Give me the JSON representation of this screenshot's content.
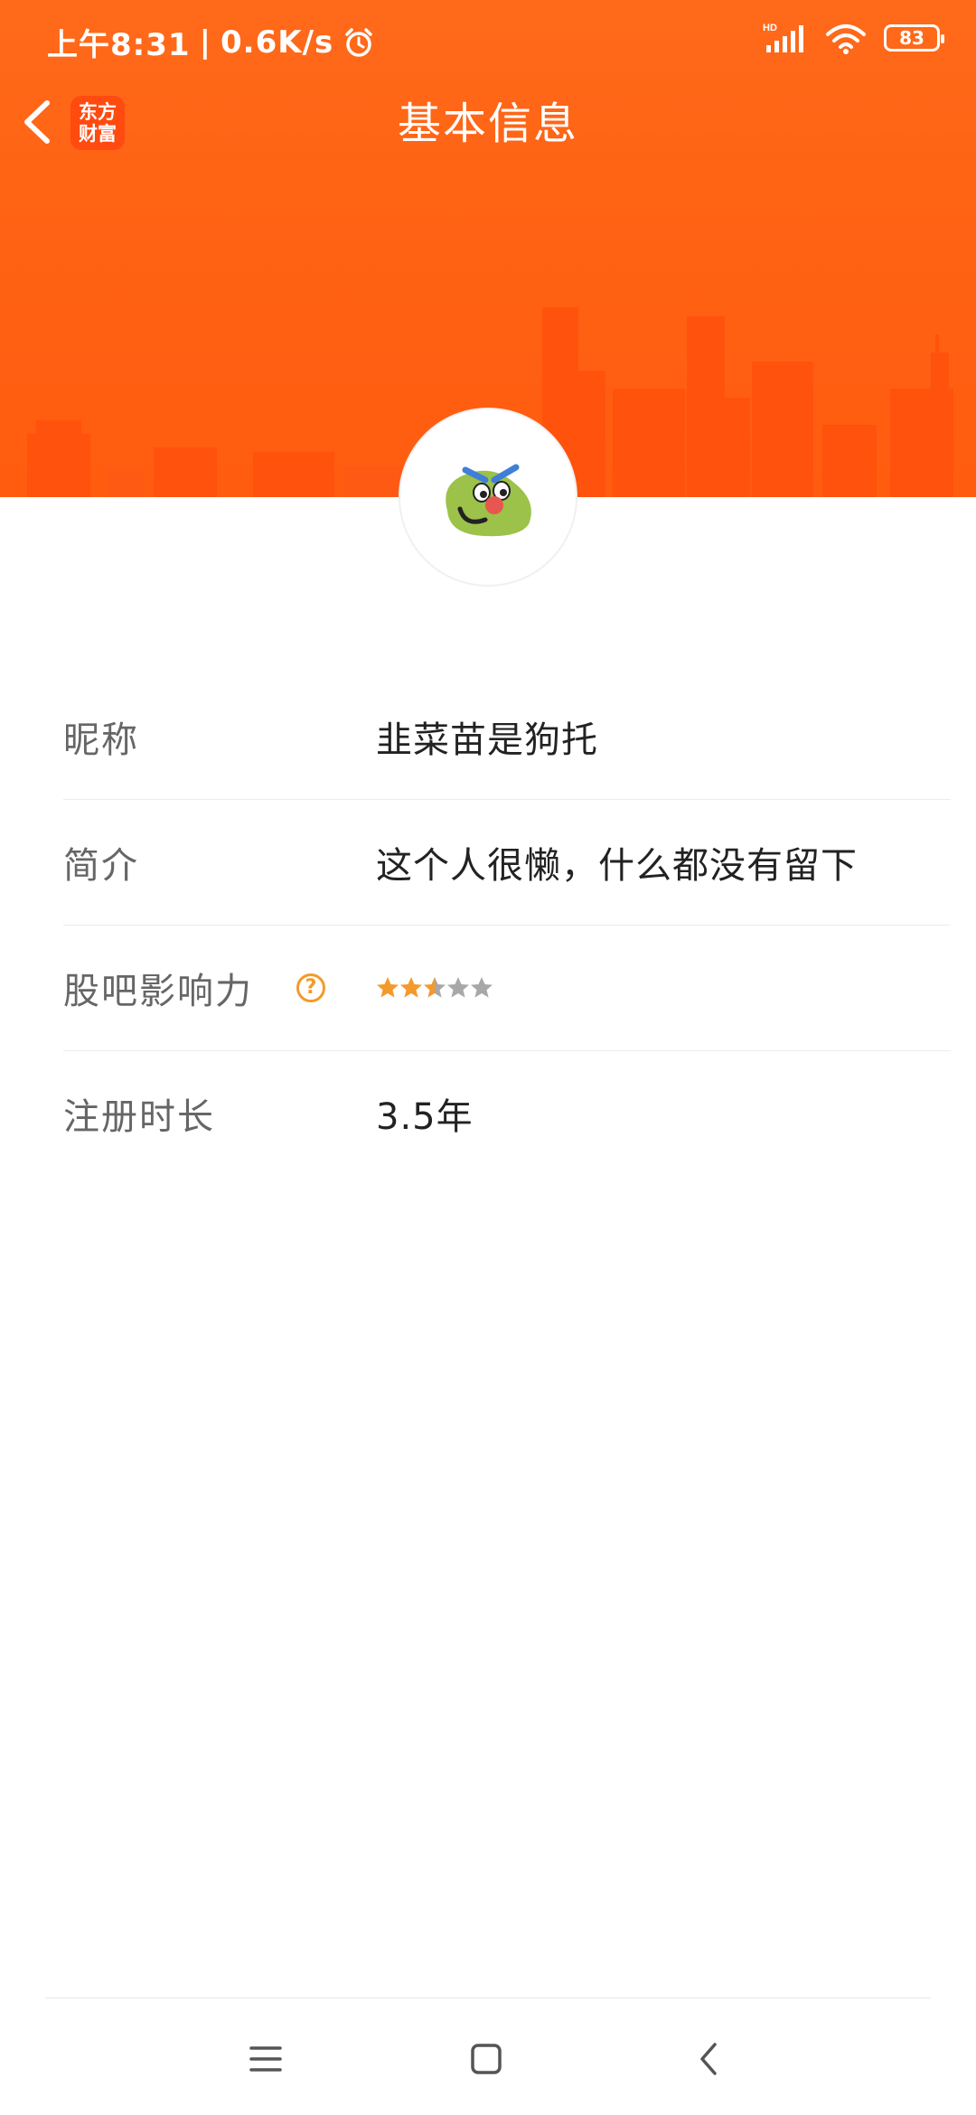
{
  "status_bar": {
    "time": "上午8:31",
    "separator": "|",
    "network_speed": "0.6K/s",
    "network_type": "HD",
    "battery": "83"
  },
  "nav": {
    "app_logo_line1": "东方",
    "app_logo_line2": "财富",
    "title": "基本信息"
  },
  "profile": {
    "rows": [
      {
        "label": "昵称",
        "value": "韭菜苗是狗托"
      },
      {
        "label": "简介",
        "value": "这个人很懒，什么都没有留下"
      },
      {
        "label": "股吧影响力",
        "rating": 2.5,
        "rating_max": 5,
        "help": "?"
      },
      {
        "label": "注册时长",
        "value": "3.5年"
      }
    ]
  },
  "colors": {
    "header_orange": "#ff6314",
    "star_active": "#f39a2b",
    "star_inactive": "#a8a8a8",
    "label_gray": "#666666",
    "value_dark": "#222222"
  },
  "icons": {
    "back": "chevron-left-icon",
    "alarm": "alarm-icon",
    "signal": "signal-icon",
    "wifi": "wifi-icon",
    "help": "question-icon",
    "menu": "menu-icon",
    "home": "home-square-icon",
    "nav_back": "back-arrow-icon"
  }
}
